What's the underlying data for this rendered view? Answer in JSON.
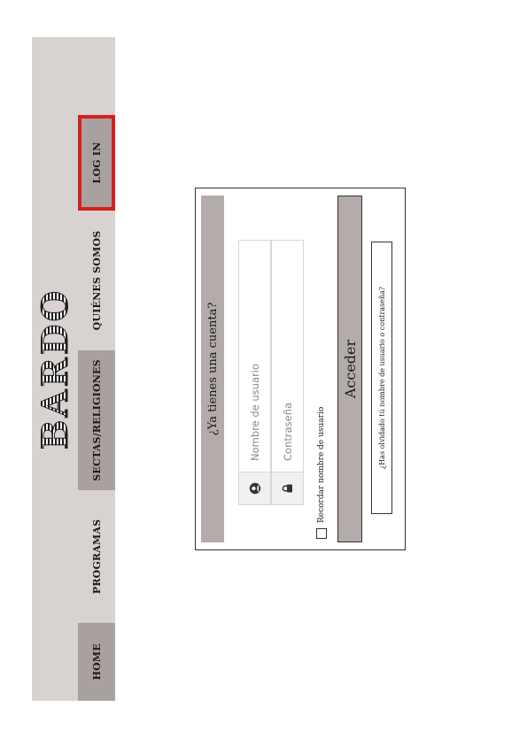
{
  "brand": {
    "name": "BARDO"
  },
  "nav": {
    "items": [
      {
        "label": "HOME"
      },
      {
        "label": "PROGRAMAS"
      },
      {
        "label": "SECTAS/RELIGIONES"
      },
      {
        "label": "QUIÉNES SOMOS"
      },
      {
        "label": "LOG IN"
      }
    ],
    "active_index": 4,
    "active_color": "#d32020"
  },
  "login": {
    "title": "¿Ya tienes una cuenta?",
    "username": {
      "placeholder": "Nombre de usuario",
      "value": "",
      "icon": "user-icon"
    },
    "password": {
      "placeholder": "Contraseña",
      "value": "",
      "icon": "lock-icon"
    },
    "remember_label": "Recordar nombre de usuario",
    "remember_checked": false,
    "submit_label": "Acceder",
    "forgot_label": "¿Has olvidado tú nombre de usuario o contraseña?"
  },
  "colors": {
    "header_bg": "#d8d2d1",
    "nav_dark": "#a9a19f",
    "panel_accent": "#b3acab"
  }
}
